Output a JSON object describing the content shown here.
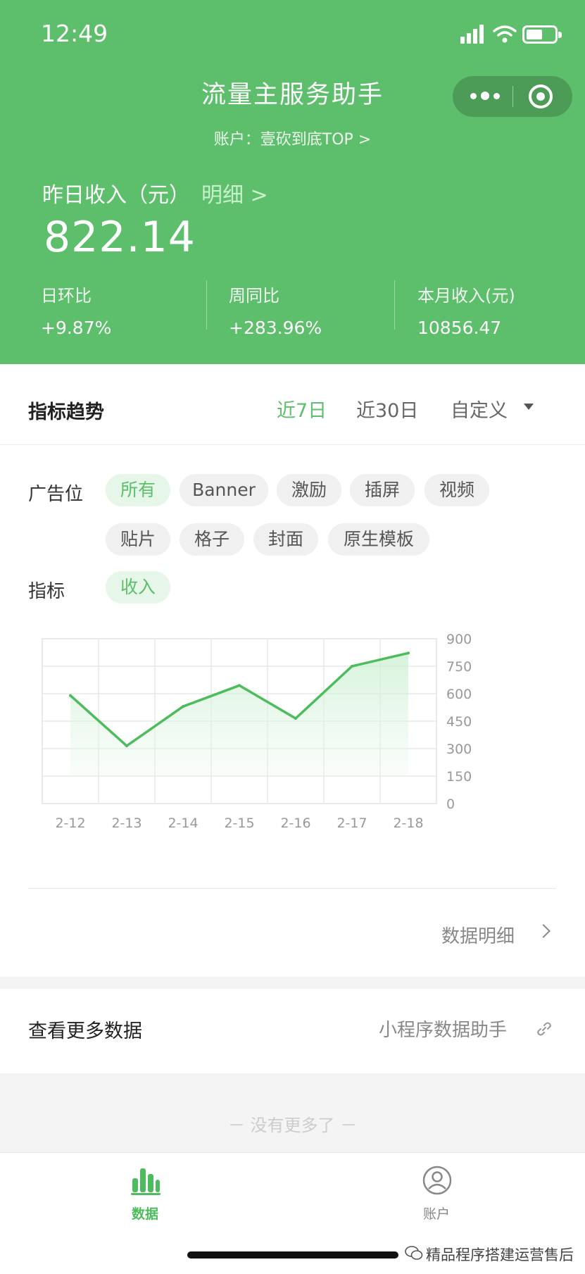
{
  "status_bar": {
    "time": "12:49"
  },
  "header": {
    "title": "流量主服务助手",
    "account_line": "账户：壹砍到底TOP  >",
    "income_label": "昨日收入（元）",
    "detail_link": "明细 >",
    "income_value": "822.14",
    "stats": [
      {
        "label": "日环比",
        "value": "+9.87%"
      },
      {
        "label": "周同比",
        "value": "+283.96%"
      },
      {
        "label": "本月收入(元)",
        "value": "10856.47"
      }
    ]
  },
  "trend": {
    "title": "指标趋势",
    "ranges": [
      "近7日",
      "近30日",
      "自定义"
    ],
    "active_range": "近7日",
    "ad_slot_label": "广告位",
    "ad_slots": [
      "所有",
      "Banner",
      "激励",
      "插屏",
      "视频",
      "贴片",
      "格子",
      "封面",
      "原生模板"
    ],
    "active_ad_slot": "所有",
    "metric_label": "指标",
    "metrics": [
      "收入"
    ],
    "detail_link": "数据明细"
  },
  "chart_data": {
    "type": "area",
    "categories": [
      "2-12",
      "2-13",
      "2-14",
      "2-15",
      "2-16",
      "2-17",
      "2-18"
    ],
    "series": [
      {
        "values": [
          590,
          315,
          530,
          645,
          465,
          750,
          822
        ]
      }
    ],
    "yticks": [
      900,
      750,
      600,
      450,
      300,
      150,
      0
    ],
    "ylim": [
      0,
      900
    ],
    "grid": true,
    "color": "#4cbc5c"
  },
  "more": {
    "title": "查看更多数据",
    "link": "小程序数据助手"
  },
  "footer": {
    "no_more": "－  没有更多了  －"
  },
  "tabbar": {
    "items": [
      {
        "label": "数据",
        "active": true
      },
      {
        "label": "账户",
        "active": false
      }
    ]
  },
  "watermark": "精品程序搭建运营售后",
  "colors": {
    "brand": "#5dbf6b",
    "accent_text": "#c8f0cc"
  }
}
